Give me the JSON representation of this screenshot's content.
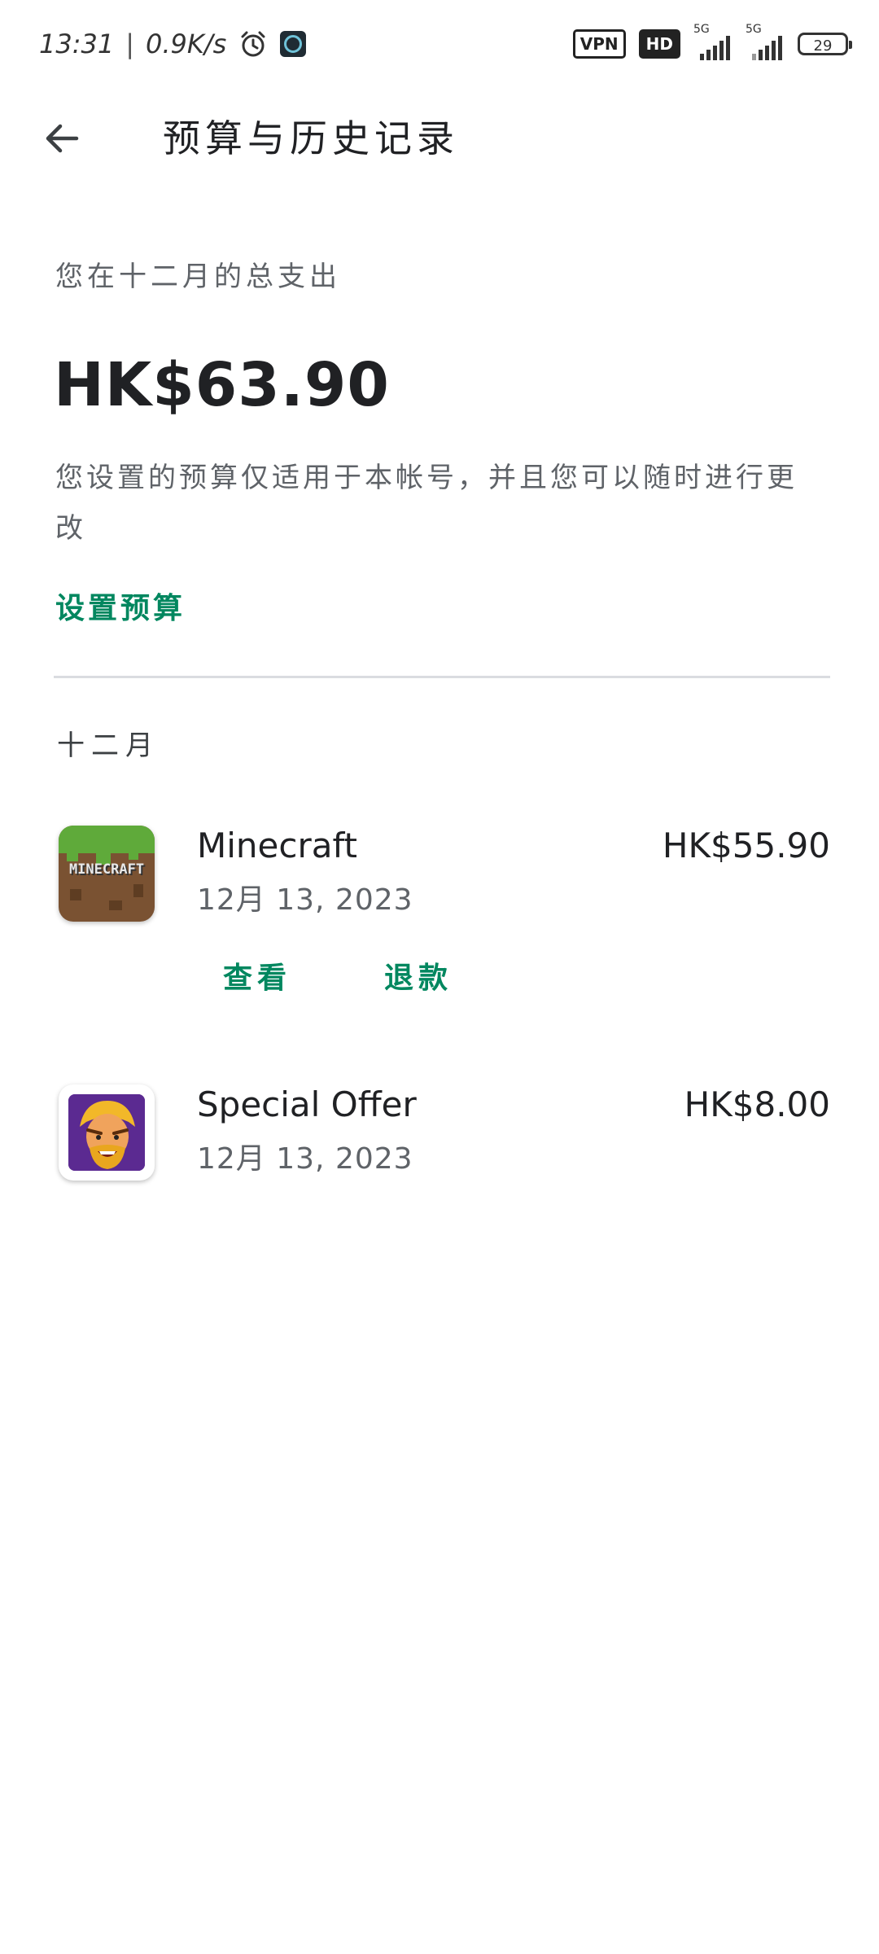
{
  "status_bar": {
    "time": "13:31",
    "separator": "|",
    "net_speed": "0.9K/s",
    "vpn_label": "VPN",
    "hd_label": "HD",
    "sim1_tag": "5G",
    "sim2_tag": "5G",
    "battery": "29"
  },
  "app_bar": {
    "title": "预算与历史记录"
  },
  "summary": {
    "label": "您在十二月的总支出",
    "total": "HK$63.90",
    "note": "您设置的预算仅适用于本帐号，并且您可以随时进行更改",
    "set_budget": "设置预算"
  },
  "month": {
    "header": "十二月"
  },
  "transactions": [
    {
      "name": "Minecraft",
      "date": "12月 13, 2023",
      "amount": "HK$55.90",
      "icon": "minecraft-icon",
      "icon_text": "MINECRAFT",
      "actions": [
        "查看",
        "退款"
      ]
    },
    {
      "name": "Special Offer",
      "date": "12月 13, 2023",
      "amount": "HK$8.00",
      "icon": "clash-of-clans-icon"
    }
  ],
  "colors": {
    "accent": "#01875f",
    "text_primary": "#202124",
    "text_secondary": "#5f6368",
    "divider": "#dadce0"
  }
}
